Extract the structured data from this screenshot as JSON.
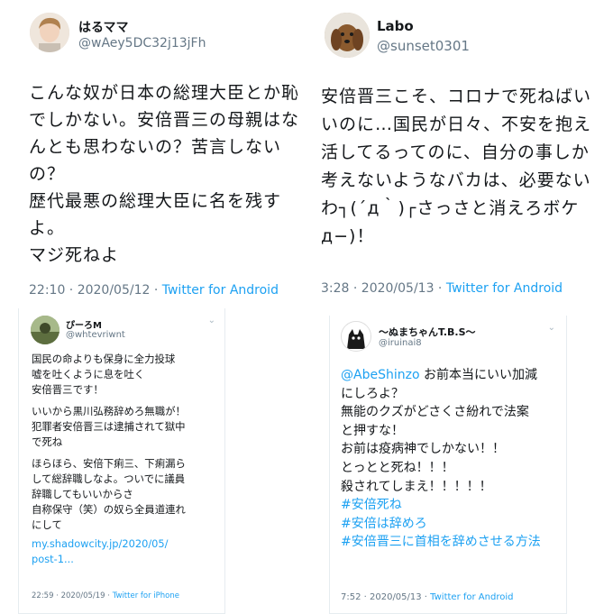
{
  "tweets": [
    {
      "name": "はるママ",
      "handle": "@wAey5DC32j13jFh",
      "lines": [
        "こんな奴が日本の総理大臣とか恥",
        "でしかない。安倍晋三の母親はな",
        "んとも思わないの？苦言しない",
        "の？",
        "歴代最悪の総理大臣に名を残す",
        "よ。",
        "マジ死ねよ"
      ],
      "time": "22:10 · 2020/05/12 · ",
      "source": "Twitter for Android",
      "avatar_icon": "user-photo-icon"
    },
    {
      "name": "Labo",
      "handle": "@sunset0301",
      "lines": [
        "安倍晋三こそ、コロナで死ねばい",
        "いのに…国民が日々、不安を抱え",
        "活してるってのに、自分の事しか",
        "考えないようなバカは、必要ない",
        "わ┐(´д｀)┌さっさと消えろボケ",
        "д−)！"
      ],
      "time": "3:28 · 2020/05/13 · ",
      "source": "Twitter for Android",
      "avatar_icon": "dog-photo-icon"
    },
    {
      "name": "ぴーろM",
      "handle": "@whtevriwnt",
      "lines": [
        "国民の命よりも保身に全力投球",
        "嘘を吐くように息を吐く",
        "安倍晋三です！",
        "",
        "いいから黒川弘務辞めろ無職が！",
        "犯罪者安倍晋三は逮捕されて獄中",
        "で死ね",
        "",
        "ほらほら、安倍下痢三、下痢漏ら",
        "して総辞職しなよ。ついでに議員",
        "辞職してもいいからさ",
        "自称保守（笑）の奴ら全員道連れ",
        "にして"
      ],
      "link_lines": [
        "my.shadowcity.jp/2020/05/",
        "post-1..."
      ],
      "time": "22:59 · 2020/05/19 · ",
      "source": "Twitter for iPhone",
      "avatar_icon": "landscape-photo-icon"
    },
    {
      "name": "〜ぬまちゃんT.B.S〜",
      "handle": "@iruinai8",
      "mention": "@AbeShinzo",
      "lines": [
        " お前本当にいい加減",
        "にしろよ？",
        "無能のクズがどさくさ紛れで法案",
        "と押すな！",
        "お前は疫病神でしかない！！",
        "とっとと死ね！！！",
        "殺されてしまえ！！！！！"
      ],
      "hashtags": [
        "#安倍死ね",
        "#安倍は辞めろ",
        "#安倍晋三に首相を辞めさせる方法"
      ],
      "time": "7:52 · 2020/05/13 · ",
      "source": "Twitter for Android",
      "avatar_icon": "cartoon-cat-icon"
    }
  ],
  "colors": {
    "link": "#1da1f2",
    "meta": "#657786",
    "text": "#14171a"
  }
}
